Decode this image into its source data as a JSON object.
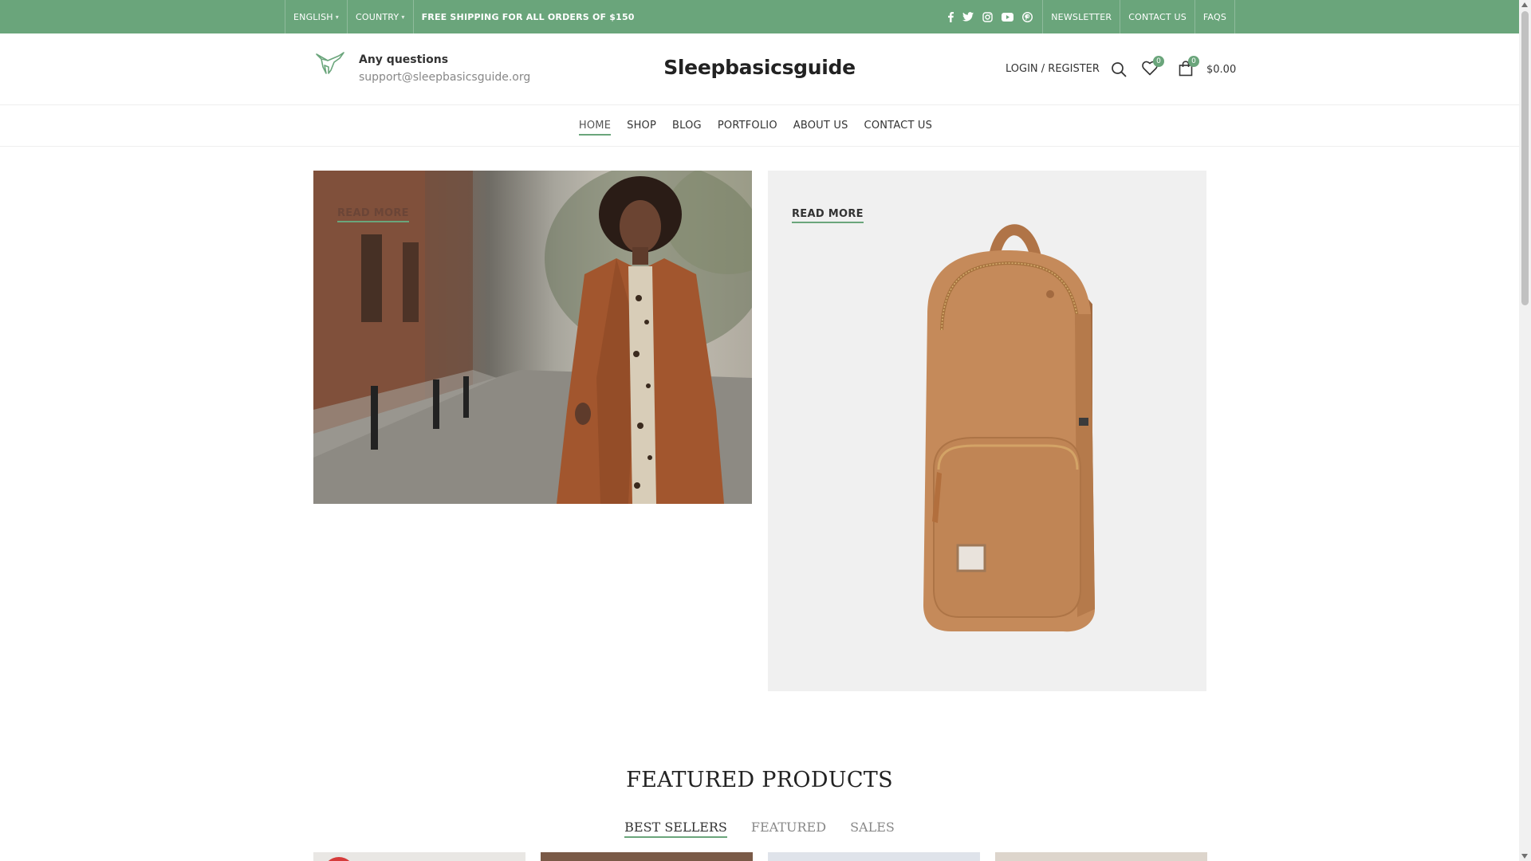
{
  "topbar": {
    "language": "ENGLISH",
    "country": "COUNTRY",
    "shipping_notice": "FREE SHIPPING FOR ALL ORDERS OF $150",
    "social": [
      "facebook-icon",
      "twitter-icon",
      "instagram-icon",
      "youtube-icon",
      "pinterest-icon"
    ],
    "links": [
      "NEWSLETTER",
      "CONTACT US",
      "FAQS"
    ]
  },
  "header": {
    "contact_title": "Any questions",
    "contact_email": "support@sleepbasicsguide.org",
    "brand": "Sleepbasicsguide",
    "login_label": "LOGIN / REGISTER",
    "wishlist_count": "0",
    "cart_count": "0",
    "cart_total": "$0.00"
  },
  "nav": {
    "items": [
      "HOME",
      "SHOP",
      "BLOG",
      "PORTFOLIO",
      "ABOUT US",
      "CONTACT US"
    ],
    "active": "HOME"
  },
  "banners": {
    "left_cta": "READ MORE",
    "right_cta": "READ MORE"
  },
  "featured": {
    "title": "FEATURED PRODUCTS",
    "tabs": [
      "BEST SELLERS",
      "FEATURED",
      "SALES"
    ],
    "active_tab": "BEST SELLERS"
  },
  "colors": {
    "accent": "#6aa57b",
    "topbar_bg": "#6aa57b",
    "badge_bg": "#6aa57b",
    "sale_badge": "#d63b3b"
  }
}
